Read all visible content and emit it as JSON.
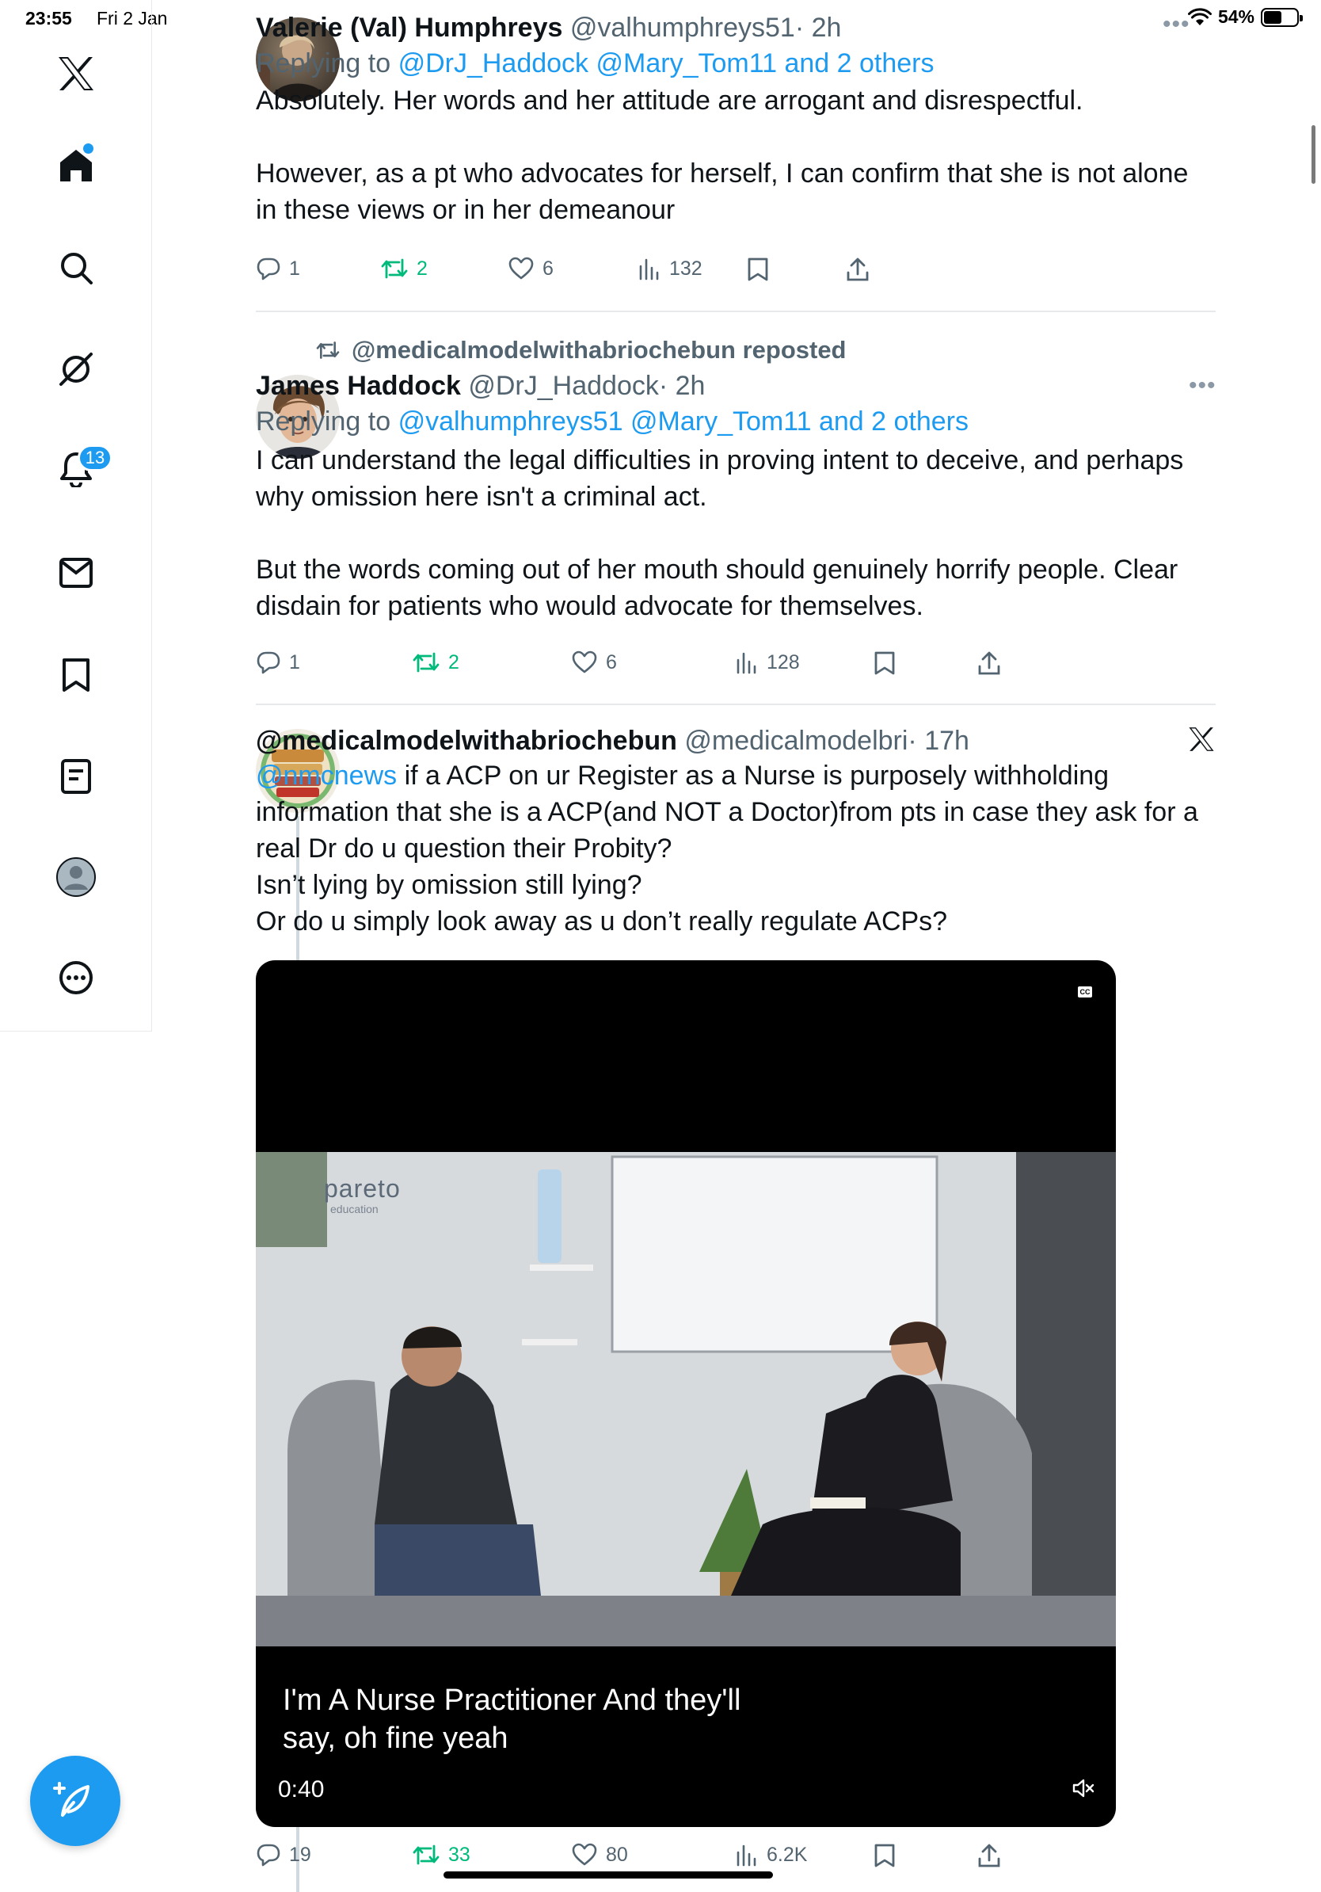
{
  "status_bar": {
    "time": "23:55",
    "date": "Fri 2 Jan",
    "battery": "54%",
    "battery_level": 0.54
  },
  "sidebar": {
    "items": [
      {
        "name": "x-logo"
      },
      {
        "name": "home"
      },
      {
        "name": "explore"
      },
      {
        "name": "grok"
      },
      {
        "name": "notifications",
        "badge": "13"
      },
      {
        "name": "messages"
      },
      {
        "name": "bookmarks"
      },
      {
        "name": "lists"
      },
      {
        "name": "profile"
      },
      {
        "name": "more"
      }
    ],
    "compose_icon": "feather-plus-icon"
  },
  "posts": [
    {
      "name": "Valerie (Val) Humphreys",
      "handle": "@valhumphreys51",
      "time": "· 2h",
      "replying_prefix": "Replying to",
      "replying_to": "@DrJ_Haddock @Mary_Tom11 and 2 others",
      "body": [
        "Absolutely. Her words and her attitude are arrogant and disrespectful.",
        "However, as a pt who advocates for herself, I can confirm that she is not alone in these views or in her demeanour"
      ],
      "stats": {
        "replies": "1",
        "reposts": "2",
        "likes": "6",
        "views": "132"
      }
    },
    {
      "repost_label": "@medicalmodelwithabriochebun reposted",
      "name": "James Haddock",
      "handle": "@DrJ_Haddock",
      "time": "· 2h",
      "replying_prefix": "Replying to",
      "replying_to": "@valhumphreys51 @Mary_Tom11 and 2 others",
      "body": [
        "I can understand the legal difficulties in proving intent to deceive, and perhaps why omission here isn't a criminal act.",
        "But the words coming out of her mouth should genuinely horrify people. Clear disdain for patients who would advocate for themselves."
      ],
      "stats": {
        "replies": "1",
        "reposts": "2",
        "likes": "6",
        "views": "128"
      }
    },
    {
      "name": "@medicalmodelwithabriochebun",
      "handle": "@medicalmodelbri",
      "time": "· 17h",
      "mention": "@nmcnews",
      "body": [
        " if a ACP on ur Register as a Nurse is purposely withholding information that she is a ACP(and NOT a Doctor)from pts in case they ask for a real Dr do u question their Probity?",
        "Isn’t lying by omission still lying?",
        "Or do u simply look away as u don’t really regulate ACPs?"
      ],
      "video": {
        "brand": "pareto",
        "brand_sub": "education",
        "caption_line1": "I'm A Nurse Practitioner And they'll",
        "caption_line2": "say, oh fine yeah",
        "duration": "0:40",
        "cc": "CC"
      },
      "stats": {
        "replies": "19",
        "reposts": "33",
        "likes": "80",
        "views": "6.2K"
      }
    }
  ]
}
